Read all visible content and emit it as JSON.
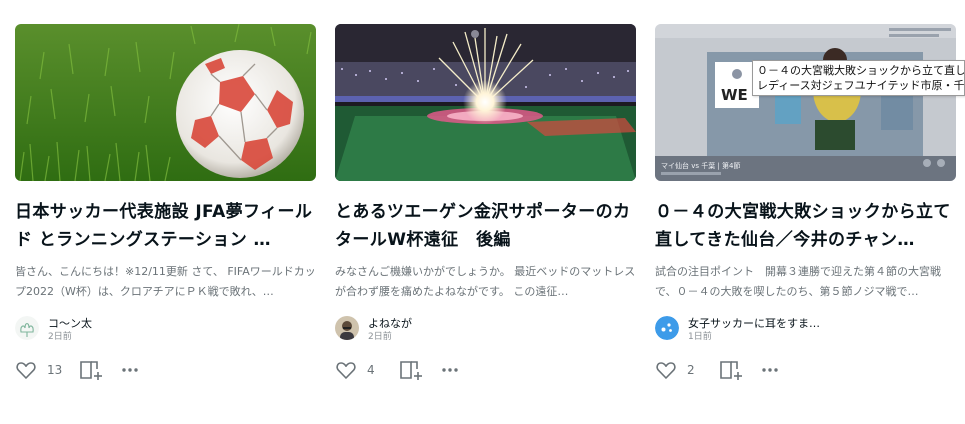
{
  "cards": [
    {
      "title": "日本サッカー代表施設 JFA夢フィールド とランニングステーション …",
      "excerpt": "皆さん、こんにちは！※12/11更新 さて、 FIFAワールドカップ2022（W杯）は、クロアチアにＰＫ戦で敗れ、…",
      "author": "コ～ン太",
      "time": "2日前",
      "likes": "13",
      "thumb_icon": "soccer-ball-image",
      "avatar_icon": "flower-avatar"
    },
    {
      "title": "とあるツエーゲン金沢サポーターのカタールW杯遠征　後編",
      "excerpt": "みなさんご機嫌いかがでしょうか。 最近ベッドのマットレスが合わず腰を痛めたよねながです。 この遠征…",
      "author": "よねなが",
      "time": "2日前",
      "likes": "4",
      "thumb_icon": "stadium-fireworks-image",
      "avatar_icon": "person-avatar"
    },
    {
      "title": "０－４の大宮戦大敗ショックから立て直してきた仙台／今井のチャン…",
      "excerpt": "試合の注目ポイント　開幕３連勝で迎えた第４節の大宮戦で、０－４の大敗を喫したのち、第５節ノジマ戦で…",
      "author": "女子サッカーに耳をすま…",
      "time": "1日前",
      "likes": "2",
      "thumb_icon": "tv-broadcast-image",
      "avatar_icon": "blue-circle-avatar"
    }
  ],
  "thumb_text": {
    "we_logo": "WE",
    "broadcast_caption": "マイ仙台 vs 千葉 | 第4節"
  },
  "tooltip": {
    "line1": "０－４の大宮戦大敗ショックから立て直し",
    "line2": "レディース対ジェフユナイテッド市原・千葉レディ"
  },
  "colors": {
    "text": "#08131a",
    "muted": "#6b7378",
    "icon": "#6b7378",
    "accent_blue": "#3d9be9"
  }
}
